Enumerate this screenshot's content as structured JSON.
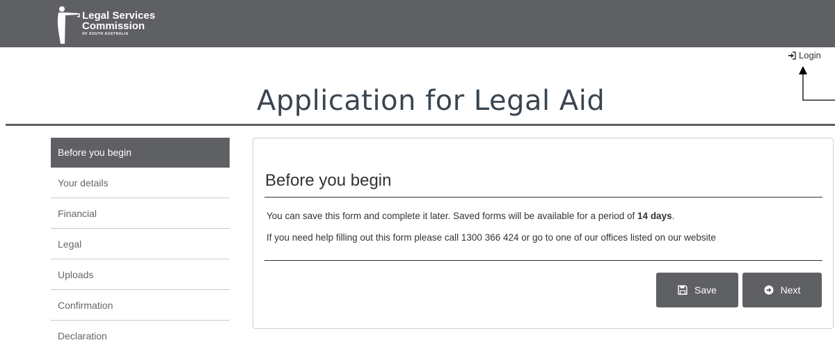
{
  "header": {
    "logo": {
      "line1": "Legal Services",
      "line2": "Commission",
      "line3": "OF SOUTH AUSTRALIA"
    },
    "login_label": "Login"
  },
  "page": {
    "title": "Application for Legal Aid"
  },
  "sidebar": {
    "items": [
      {
        "label": "Before you begin"
      },
      {
        "label": "Your details"
      },
      {
        "label": "Financial"
      },
      {
        "label": "Legal"
      },
      {
        "label": "Uploads"
      },
      {
        "label": "Confirmation"
      },
      {
        "label": "Declaration"
      }
    ]
  },
  "panel": {
    "title": "Before you begin",
    "text1_prefix": "You can save this form and complete it later. Saved forms will be available for a period of ",
    "text1_bold": "14 days",
    "text1_suffix": ".",
    "text2": "If you need help filling out this form please call 1300 366 424 or go to one of our offices listed on our website"
  },
  "buttons": {
    "save_label": "Save",
    "next_label": "Next"
  },
  "colors": {
    "header_bg": "#5f6064",
    "active_nav_bg": "#5f6064",
    "button_bg": "#5f6064",
    "title_color": "#3a4550"
  },
  "icons": {
    "login": "sign-in-icon",
    "save": "floppy-disk-icon",
    "next": "circle-arrow-right-icon"
  }
}
